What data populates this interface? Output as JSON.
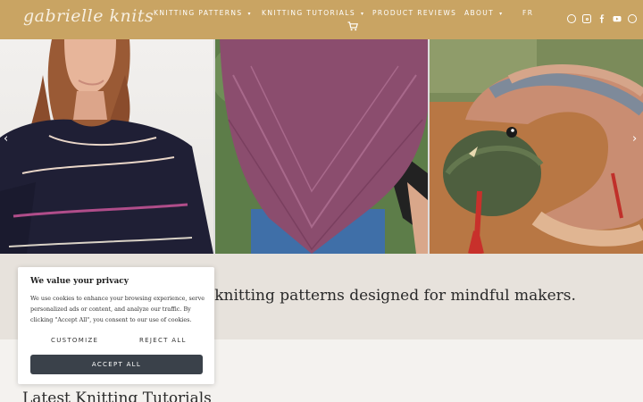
{
  "header": {
    "logo": "gabrielle knits",
    "nav": [
      {
        "label": "KNITTING PATTERNS",
        "has_caret": true
      },
      {
        "label": "KNITTING TUTORIALS",
        "has_caret": true
      },
      {
        "label": "PRODUCT REVIEWS",
        "has_caret": false
      },
      {
        "label": "ABOUT",
        "has_caret": true
      },
      {
        "label": "FR",
        "has_caret": false
      }
    ],
    "caret_glyph": "▾",
    "cart_icon": "shopping-cart-icon",
    "social_icons": [
      "ravelry-icon",
      "instagram-icon",
      "facebook-icon",
      "youtube-icon",
      "pinterest-icon"
    ],
    "colors": {
      "header_bg": "#c9a463",
      "text": "#ffffff"
    }
  },
  "hero": {
    "slides": [
      "sweater-photo",
      "shawl-photo",
      "snake-toy-photo"
    ],
    "prev_glyph": "‹",
    "next_glyph": "›"
  },
  "tagline": "t knitting patterns designed for mindful makers.",
  "section_heading": "Latest Knitting Tutorials",
  "cookie": {
    "title": "We value your privacy",
    "text": "We use cookies to enhance your browsing experience, serve personalized ads or content, and analyze our traffic. By clicking \"Accept All\", you consent to our use of cookies.",
    "customize": "CUSTOMIZE",
    "reject": "REJECT ALL",
    "accept": "ACCEPT ALL",
    "colors": {
      "accept_bg": "#3a414a"
    }
  }
}
